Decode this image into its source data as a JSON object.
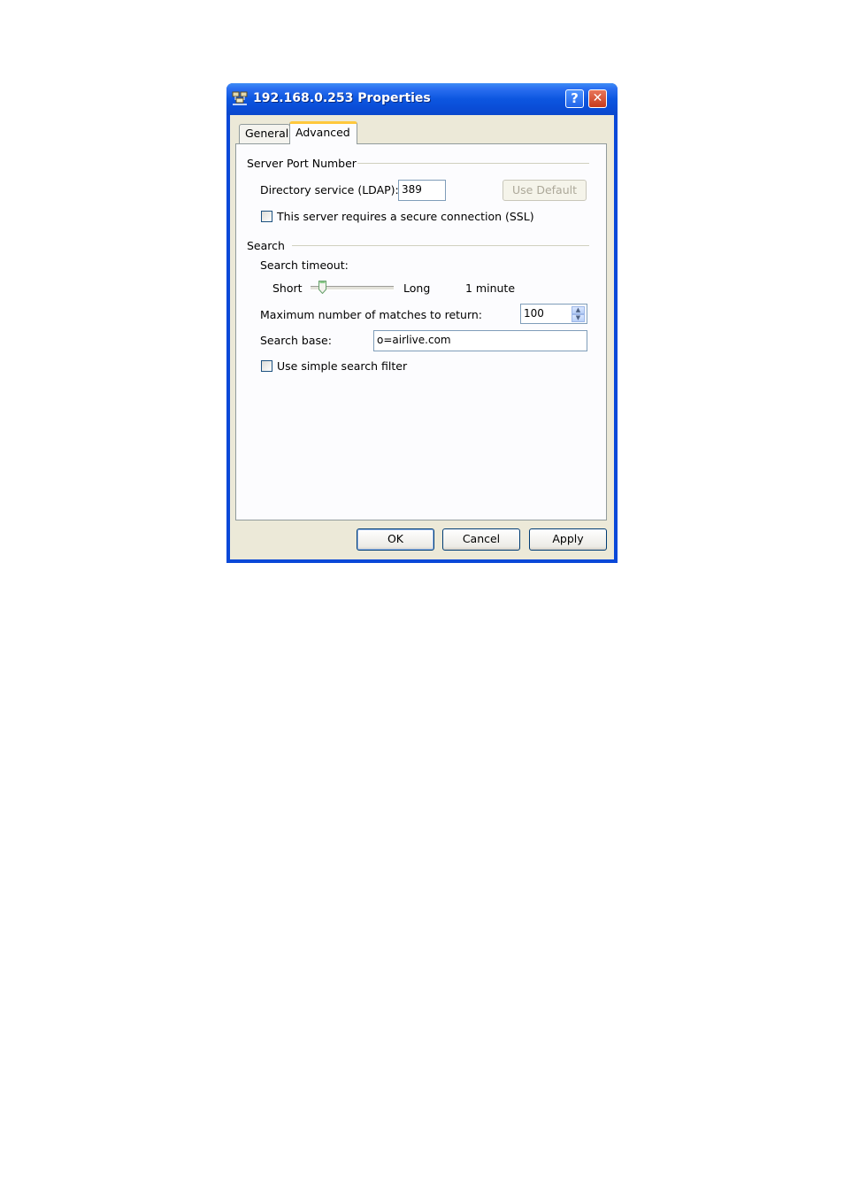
{
  "window": {
    "title": "192.168.0.253 Properties",
    "help_label": "?",
    "close_label": "✕"
  },
  "tabs": [
    {
      "label": "General",
      "active": false
    },
    {
      "label": "Advanced",
      "active": true
    }
  ],
  "server_port": {
    "group_label": "Server Port Number",
    "ldap_label": "Directory service (LDAP):",
    "ldap_value": "389",
    "use_default_label": "Use Default",
    "ssl_label": "This server requires a secure connection (SSL)",
    "ssl_checked": false
  },
  "search": {
    "group_label": "Search",
    "timeout_label": "Search timeout:",
    "short_label": "Short",
    "long_label": "Long",
    "timeout_value": "1 minute",
    "slider_level": 0.1,
    "max_matches_label": "Maximum number of matches to return:",
    "max_matches_value": "100",
    "base_label": "Search base:",
    "base_value": "o=airlive.com",
    "simple_filter_label": "Use simple search filter",
    "simple_filter_checked": false
  },
  "buttons": {
    "ok": "OK",
    "cancel": "Cancel",
    "apply": "Apply"
  },
  "colors": {
    "titlebar": "#0a4cd6",
    "dialog_bg": "#ece9d8",
    "active_tab_accent": "#ffc83c"
  }
}
